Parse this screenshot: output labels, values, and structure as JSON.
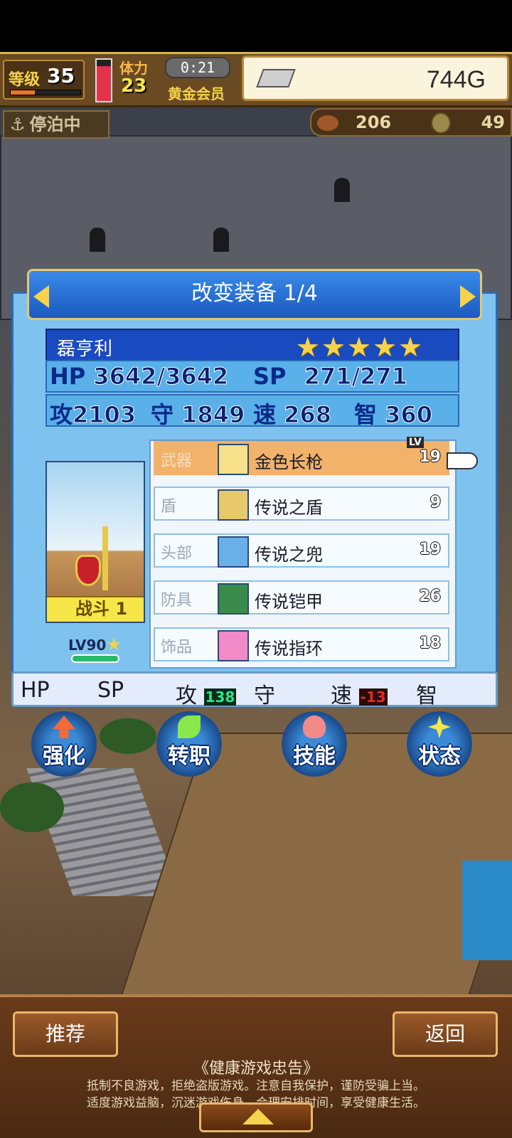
{
  "status_bar": {
    "level_label": "等级",
    "level": "35",
    "exp_fraction": 0.35,
    "hp_gauge_fraction": 0.85,
    "stamina_label": "体力",
    "stamina": "23",
    "timer": "0:21",
    "membership": "黄金会员",
    "gold": "744G"
  },
  "docking": {
    "label": "停泊中"
  },
  "resources": {
    "food": "206",
    "coins": "49"
  },
  "panel": {
    "title": "改变装备 1/4",
    "character": {
      "name": "磊亨利",
      "stars": "★★★★★",
      "hp_label": "HP",
      "hp": "3642/3642",
      "sp_label": "SP",
      "sp": "271/271",
      "atk_label": "攻",
      "atk": "2103",
      "def_label": "守",
      "def": "1849",
      "spd_label": "速",
      "spd": "268",
      "int_label": "智",
      "int": "360",
      "job_badge": "战斗",
      "job_rank": "1",
      "level_text": "LV90"
    },
    "lv_tag": "LV",
    "equipment": [
      {
        "slot": "武器",
        "name": "金色长枪",
        "lv": "19",
        "icon": "spear-icon",
        "color": "#f6e08a"
      },
      {
        "slot": "盾",
        "name": "传说之盾",
        "lv": "9",
        "icon": "shield-icon",
        "color": "#e8c86a"
      },
      {
        "slot": "头部",
        "name": "传说之兜",
        "lv": "19",
        "icon": "helmet-icon",
        "color": "#6ab0e8"
      },
      {
        "slot": "防具",
        "name": "传说铠甲",
        "lv": "26",
        "icon": "armor-icon",
        "color": "#3a8a4a"
      },
      {
        "slot": "饰品",
        "name": "传说指环",
        "lv": "18",
        "icon": "ring-icon",
        "color": "#f28ac8"
      }
    ],
    "summary": {
      "hp": "HP",
      "sp": "SP",
      "atk": "攻",
      "atk_change": "138",
      "def": "守",
      "spd": "速",
      "spd_change": "-13",
      "int": "智"
    }
  },
  "actions": [
    {
      "label": "强化",
      "icon": "arrow-up-icon",
      "color": "#f26a3a"
    },
    {
      "label": "转职",
      "icon": "leaf-icon",
      "color": "#8ae84a"
    },
    {
      "label": "技能",
      "icon": "flame-icon",
      "color": "#f28a8a"
    },
    {
      "label": "状态",
      "icon": "sparkle-icon",
      "color": "#f6e64a"
    }
  ],
  "bottom": {
    "recommend": "推荐",
    "back": "返回",
    "notice_title": "《健康游戏忠告》",
    "notice_line1": "抵制不良游戏，拒绝盗版游戏。注意自我保护，谨防受骗上当。",
    "notice_line2": "适度游戏益脑，沉迷游戏伤身。合理安排时间，享受健康生活。"
  }
}
